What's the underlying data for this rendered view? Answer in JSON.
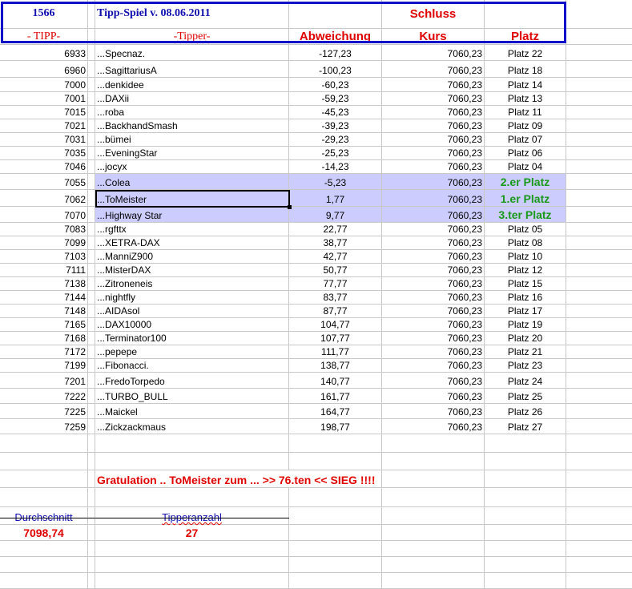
{
  "header": {
    "id": "1566",
    "title": "Tipp-Spiel v. 08.06.2011",
    "schluss": "Schluss",
    "col_tipp": "- TIPP-",
    "col_tipper": "-Tipper-",
    "col_abweichung": "Abweichung",
    "col_kurs": "Kurs",
    "col_platz": "Platz"
  },
  "rows": [
    {
      "tipp": "6933",
      "tipper": "...Specnaz.",
      "abw": "-127,23",
      "kurs": "7060,23",
      "platz": "Platz 22"
    },
    {
      "tipp": "6960",
      "tipper": "...SagittariusA",
      "abw": "-100,23",
      "kurs": "7060,23",
      "platz": "Platz 18"
    },
    {
      "tipp": "7000",
      "tipper": "...denkidee",
      "abw": "-60,23",
      "kurs": "7060,23",
      "platz": "Platz 14"
    },
    {
      "tipp": "7001",
      "tipper": "...DAXii",
      "abw": "-59,23",
      "kurs": "7060,23",
      "platz": "Platz 13"
    },
    {
      "tipp": "7015",
      "tipper": "...roba",
      "abw": "-45,23",
      "kurs": "7060,23",
      "platz": "Platz 11"
    },
    {
      "tipp": "7021",
      "tipper": "...BackhandSmash",
      "abw": "-39,23",
      "kurs": "7060,23",
      "platz": "Platz 09"
    },
    {
      "tipp": "7031",
      "tipper": "...bümei",
      "abw": "-29,23",
      "kurs": "7060,23",
      "platz": "Platz 07"
    },
    {
      "tipp": "7035",
      "tipper": "...EveningStar",
      "abw": "-25,23",
      "kurs": "7060,23",
      "platz": "Platz 06"
    },
    {
      "tipp": "7046",
      "tipper": "...jocyx",
      "abw": "-14,23",
      "kurs": "7060,23",
      "platz": "Platz 04"
    },
    {
      "tipp": "7055",
      "tipper": "...Colea",
      "abw": "-5,23",
      "kurs": "7060,23",
      "platz": "2.er Platz",
      "highlight": true
    },
    {
      "tipp": "7062",
      "tipper": "...ToMeister",
      "abw": "1,77",
      "kurs": "7060,23",
      "platz": "1.er Platz",
      "highlight": true,
      "selected": true
    },
    {
      "tipp": "7070",
      "tipper": "...Highway Star",
      "abw": "9,77",
      "kurs": "7060,23",
      "platz": "3.ter Platz",
      "highlight": true
    },
    {
      "tipp": "7083",
      "tipper": "...rgfttx",
      "abw": "22,77",
      "kurs": "7060,23",
      "platz": "Platz 05"
    },
    {
      "tipp": "7099",
      "tipper": "...XETRA-DAX",
      "abw": "38,77",
      "kurs": "7060,23",
      "platz": "Platz 08"
    },
    {
      "tipp": "7103",
      "tipper": "...ManniZ900",
      "abw": "42,77",
      "kurs": "7060,23",
      "platz": "Platz 10"
    },
    {
      "tipp": "7111",
      "tipper": "...MisterDAX",
      "abw": "50,77",
      "kurs": "7060,23",
      "platz": "Platz 12"
    },
    {
      "tipp": "7138",
      "tipper": "...Zitroneneis",
      "abw": "77,77",
      "kurs": "7060,23",
      "platz": "Platz 15"
    },
    {
      "tipp": "7144",
      "tipper": "...nightfly",
      "abw": "83,77",
      "kurs": "7060,23",
      "platz": "Platz 16"
    },
    {
      "tipp": "7148",
      "tipper": "...AIDAsol",
      "abw": "87,77",
      "kurs": "7060,23",
      "platz": "Platz 17"
    },
    {
      "tipp": "7165",
      "tipper": "...DAX10000",
      "abw": "104,77",
      "kurs": "7060,23",
      "platz": "Platz 19"
    },
    {
      "tipp": "7168",
      "tipper": "...Terminator100",
      "abw": "107,77",
      "kurs": "7060,23",
      "platz": "Platz 20"
    },
    {
      "tipp": "7172",
      "tipper": "...pepepe",
      "abw": "111,77",
      "kurs": "7060,23",
      "platz": "Platz 21"
    },
    {
      "tipp": "7199",
      "tipper": "...Fibonacci.",
      "abw": "138,77",
      "kurs": "7060,23",
      "platz": "Platz 23"
    },
    {
      "tipp": "7201",
      "tipper": "...FredoTorpedo",
      "abw": "140,77",
      "kurs": "7060,23",
      "platz": "Platz 24"
    },
    {
      "tipp": "7222",
      "tipper": "...TURBO_BULL",
      "abw": "161,77",
      "kurs": "7060,23",
      "platz": "Platz 25"
    },
    {
      "tipp": "7225",
      "tipper": "...Maickel",
      "abw": "164,77",
      "kurs": "7060,23",
      "platz": "Platz 26"
    },
    {
      "tipp": "7259",
      "tipper": "...Zickzackmaus",
      "abw": "198,77",
      "kurs": "7060,23",
      "platz": "Platz 27"
    }
  ],
  "footer": {
    "message": "Gratulation .. ToMeister zum ... >> 76.ten <<   SIEG !!!!",
    "durchschnitt_label": "Durchschnitt",
    "durchschnitt_value": "7098,74",
    "tipperanzahl_label": "Tipperanzahl",
    "tipperanzahl_value": "27"
  },
  "colors": {
    "accent_blue": "#1010c8",
    "red": "#e00000",
    "green": "#1a9a1a",
    "highlight": "#ccccff"
  }
}
